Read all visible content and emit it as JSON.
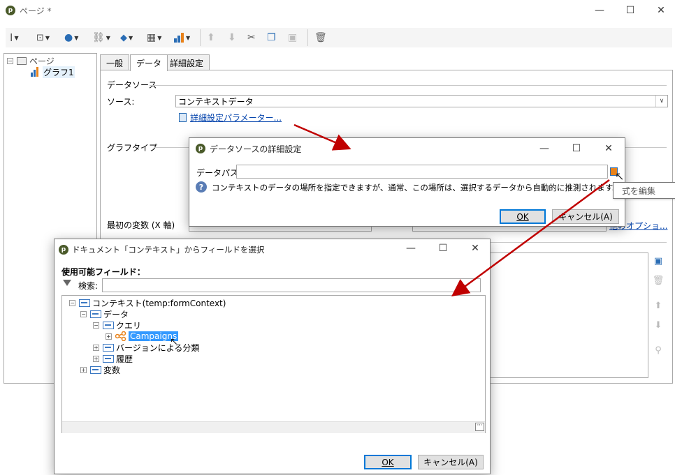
{
  "window": {
    "title": "ページ *"
  },
  "tree": {
    "root": "ページ",
    "child": "グラフ1"
  },
  "tabs": [
    {
      "label": "一般"
    },
    {
      "label": "データ"
    },
    {
      "label": "詳細設定"
    }
  ],
  "data_tab": {
    "datasource_section": "データソース",
    "source_label": "ソース:",
    "source_value": "コンテキストデータ",
    "advanced_link": "詳細設定パラメーター...",
    "graph_type_section": "グラフタイプ",
    "first_var_label": "最初の変数 (X 軸)",
    "options_link": "他のオプショ..."
  },
  "ds_dialog": {
    "title": "データソースの詳細設定",
    "datapath_label": "データパス:",
    "datapath_value": "",
    "info_text": "コンテキストのデータの場所を指定できますが、通常、この場所は、選択するデータから自動的に推測されます。",
    "ok": "OK",
    "cancel": "キャンセル(A)"
  },
  "tooltip": {
    "text": "式を編集"
  },
  "field_dialog": {
    "title": "ドキュメント「コンテキスト」からフィールドを選択",
    "available_label": "使用可能フィールド：",
    "search_label": "検索:",
    "search_value": "",
    "tree": [
      {
        "label": "コンテキスト(temp:formContext)"
      },
      {
        "label": "データ"
      },
      {
        "label": "クエリ"
      },
      {
        "label": "Campaigns"
      },
      {
        "label": "バージョンによる分類"
      },
      {
        "label": "履歴"
      },
      {
        "label": "変数"
      }
    ],
    "ok": "OK",
    "cancel": "キャンセル(A)"
  },
  "colors": {
    "accent": "#0078d7",
    "arrow": "#c00000",
    "link": "#0645ad",
    "selection": "#3399ff"
  }
}
